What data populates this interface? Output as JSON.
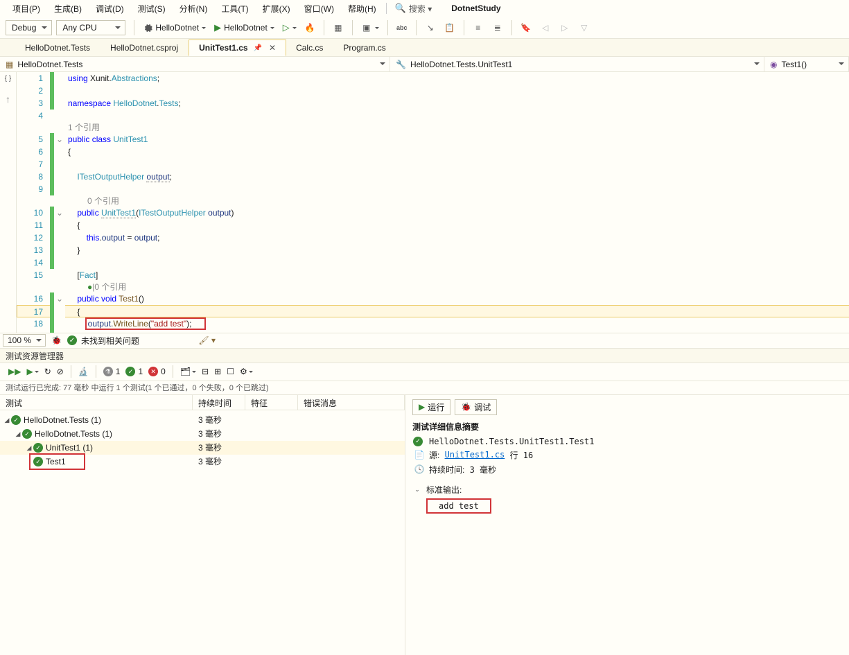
{
  "menubar": {
    "items": [
      "项目(P)",
      "生成(B)",
      "调试(D)",
      "测试(S)",
      "分析(N)",
      "工具(T)",
      "扩展(X)",
      "窗口(W)",
      "帮助(H)"
    ],
    "search": "搜索 ▾",
    "app": "DotnetStudy"
  },
  "toolbar": {
    "config": "Debug",
    "platform": "Any CPU",
    "target1": "HelloDotnet",
    "target2": "HelloDotnet"
  },
  "tabs": [
    "HelloDotnet.Tests",
    "HelloDotnet.csproj",
    "UnitTest1.cs",
    "Calc.cs",
    "Program.cs"
  ],
  "activeTabIndex": 2,
  "navbar": {
    "scope": "HelloDotnet.Tests",
    "type": "HelloDotnet.Tests.UnitTest1",
    "member": "Test1()"
  },
  "status": {
    "zoom": "100 %",
    "msg": "未找到相关问题"
  },
  "testExplorer": {
    "title": "测试资源管理器",
    "counts": {
      "flask": "1",
      "pass": "1",
      "fail": "0"
    },
    "subtitle": "测试运行已完成: 77 毫秒 中运行 1 个测试(1 个已通过，0 个失败，0 个已跳过)",
    "cols": [
      "测试",
      "持续时间",
      "特征",
      "错误消息"
    ],
    "tree": [
      {
        "indent": 0,
        "name": "HelloDotnet.Tests  (1)",
        "dur": "3 毫秒"
      },
      {
        "indent": 1,
        "name": "HelloDotnet.Tests  (1)",
        "dur": "3 毫秒"
      },
      {
        "indent": 2,
        "name": "UnitTest1  (1)",
        "dur": "3 毫秒",
        "sel": true
      },
      {
        "indent": 3,
        "name": "Test1",
        "dur": "3 毫秒",
        "red": true
      }
    ],
    "detail": {
      "run": "运行",
      "debug": "调试",
      "summary": "测试详细信息摘要",
      "fqn": "HelloDotnet.Tests.UnitTest1.Test1",
      "source_label": "源:",
      "source_file": "UnitTest1.cs",
      "source_line": "行 16",
      "duration_label": "持续时间:",
      "duration": "3 毫秒",
      "stdout_label": "标准输出:",
      "stdout": "add test"
    }
  },
  "code": {
    "refs1": "1 个引用",
    "refs0": "0 个引用",
    "refs_pass": "|0 个引用"
  }
}
